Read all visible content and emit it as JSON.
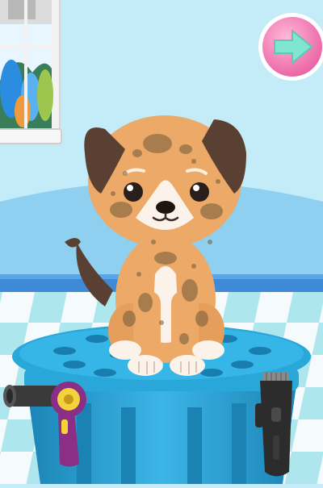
{
  "scene": {
    "name": "pet-wash-station",
    "pet": "puppy",
    "state": "dirty"
  },
  "colors": {
    "wall": "#c3ecf8",
    "wall_arch": "#8fd0f0",
    "baseboard": "#3f8ad6",
    "floor_teal": "#aee6ee",
    "floor_white": "#f5fbfc",
    "stand": "#2aa7d9",
    "stand_dark": "#1c84b6",
    "dog_fur": "#eda967",
    "dog_ears": "#5a4033",
    "dog_muzzle": "#fbf3ea",
    "dirt": "#6f5a3a",
    "next_button": "#f383b8",
    "next_arrow": "#7fe6cf",
    "dryer_handle": "#8a2e86",
    "dryer_accent": "#f3d23a",
    "clipper": "#2c2c2c"
  },
  "tools": [
    {
      "name": "hair-dryer",
      "icon": "hair-dryer-icon"
    },
    {
      "name": "hair-clipper",
      "icon": "hair-clipper-icon"
    }
  ],
  "navigation": {
    "next_icon": "arrow-right-icon"
  }
}
